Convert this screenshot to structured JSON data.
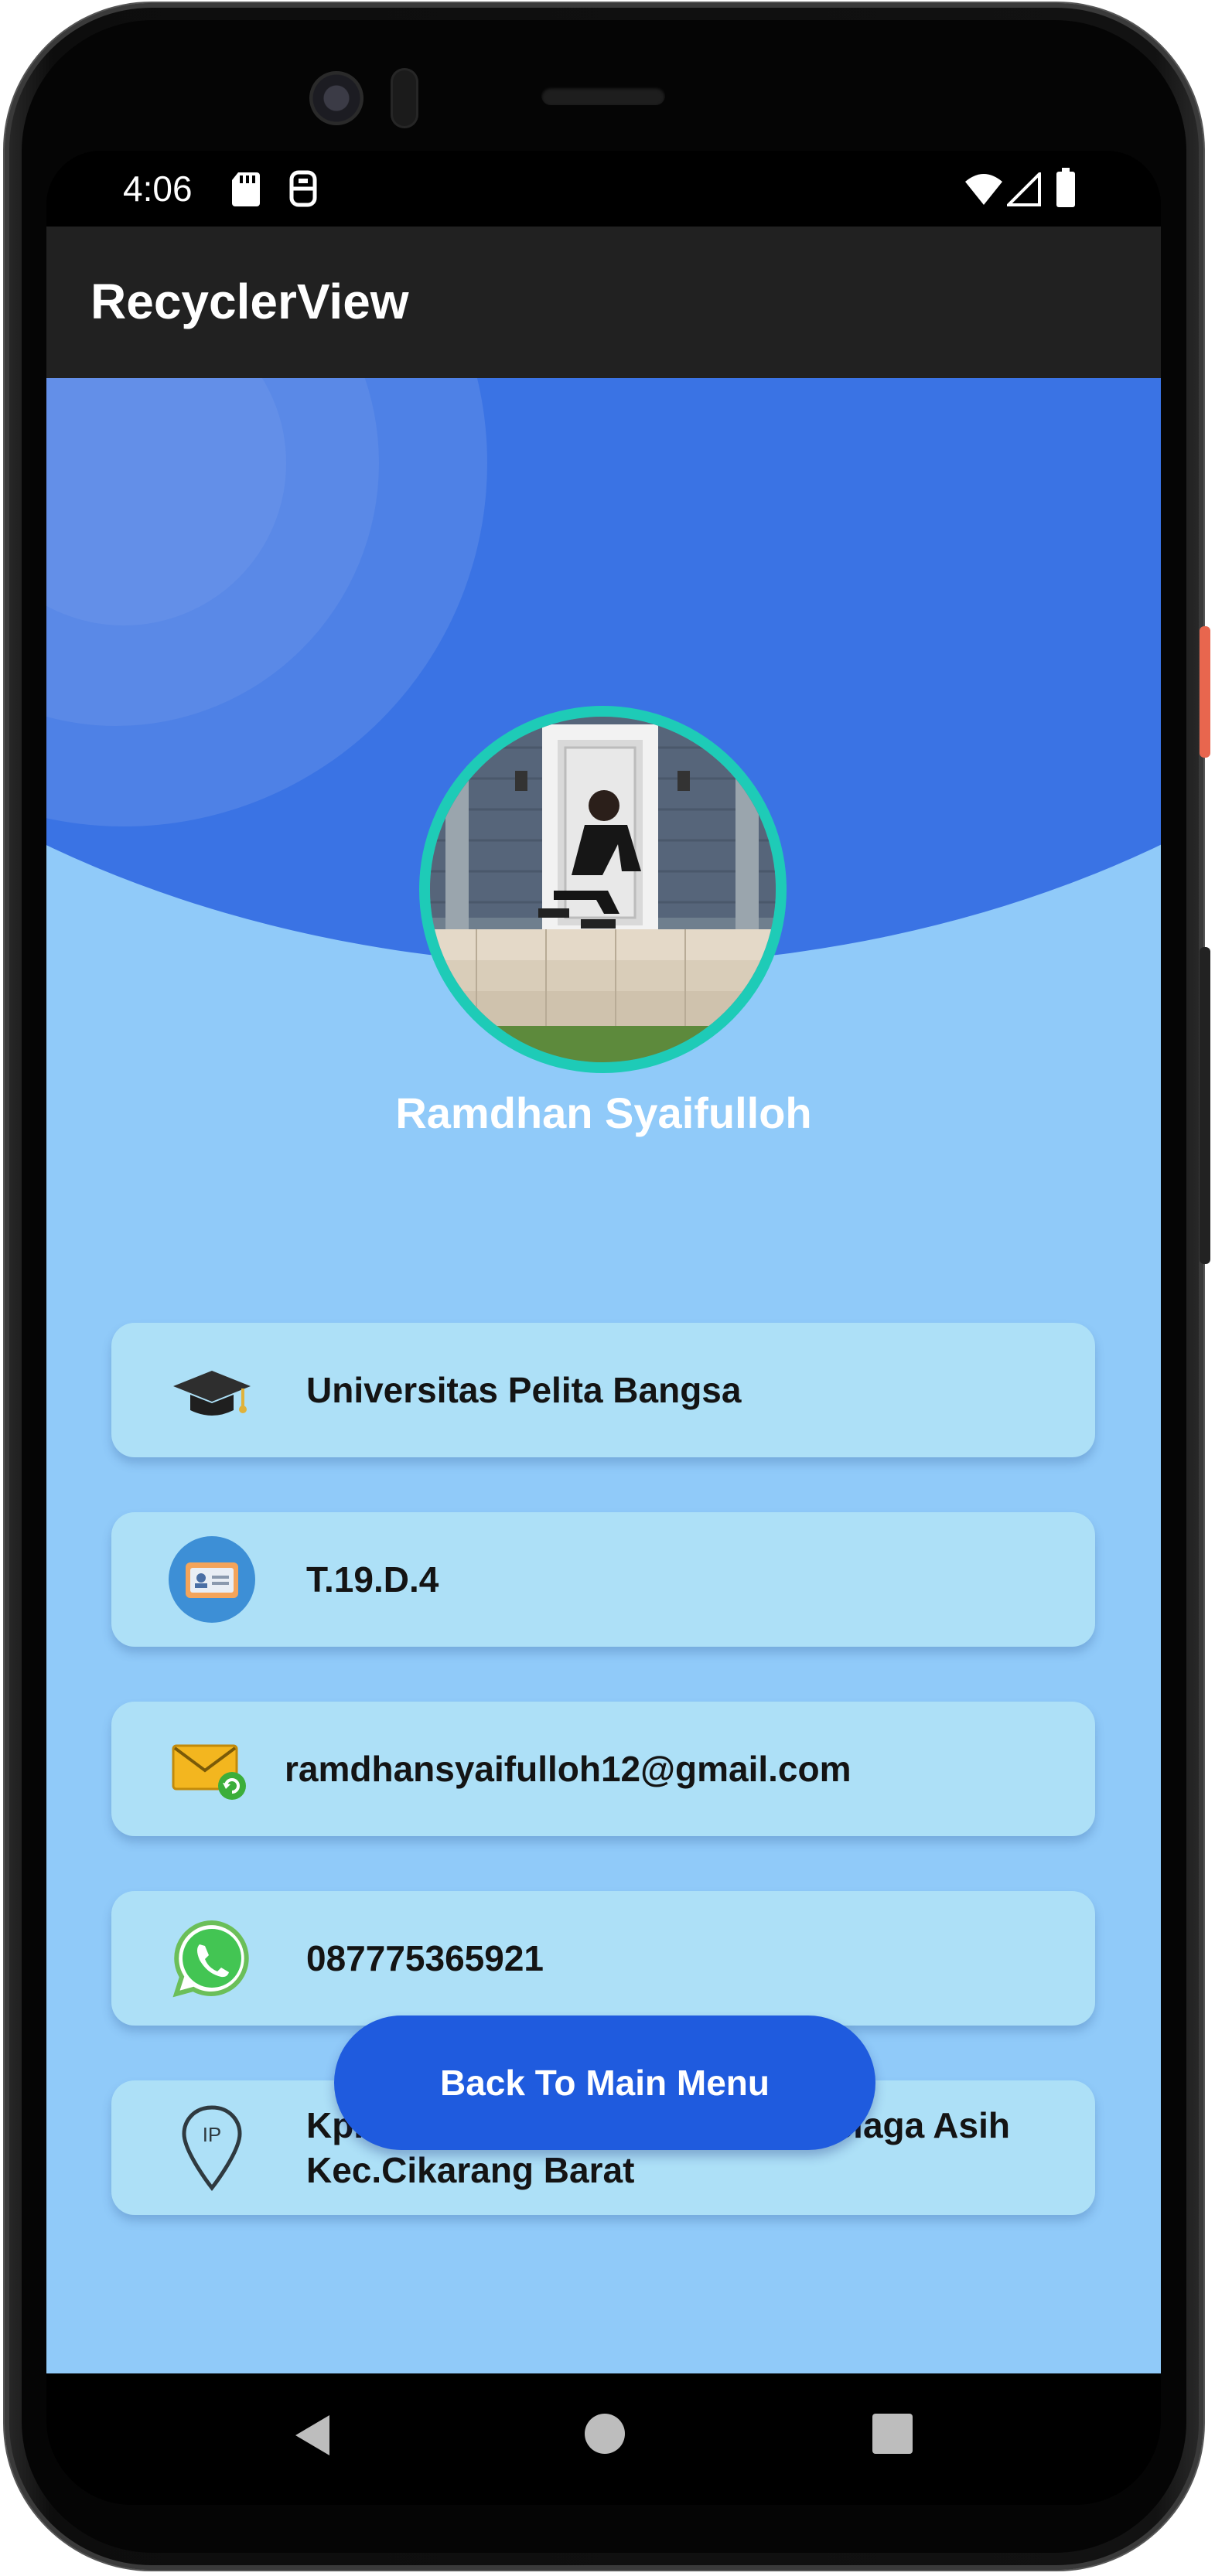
{
  "status_bar": {
    "time": "4:06",
    "icons": [
      "sd-card-icon",
      "accessibility-icon",
      "wifi-icon",
      "signal-icon",
      "battery-icon"
    ]
  },
  "app_bar": {
    "title": "RecyclerView"
  },
  "profile": {
    "name": "Ramdhan Syaifulloh",
    "avatar_border_color": "#1ecbb7"
  },
  "info_items": [
    {
      "icon": "graduation-cap-icon",
      "text": "Universitas Pelita Bangsa"
    },
    {
      "icon": "id-card-icon",
      "text": "T.19.D.4"
    },
    {
      "icon": "email-icon",
      "text": "ramdhansyaifulloh12@gmail.com"
    },
    {
      "icon": "whatsapp-icon",
      "text": "087775365921"
    },
    {
      "icon": "location-pin-icon",
      "text": "Kp.Cibitun Rt04/02 No.10, Kel.Telaga Asih Kec.Cikarang Barat"
    }
  ],
  "back_button": {
    "label": "Back To Main Menu"
  },
  "nav_bar": {
    "buttons": [
      "back-icon",
      "home-icon",
      "recents-icon"
    ]
  },
  "colors": {
    "header_blue": "#3a73e4",
    "background_light_blue": "#90caf9",
    "card_blue": "#ade0f7",
    "button_blue": "#1f5bde",
    "app_bar": "#212121"
  }
}
